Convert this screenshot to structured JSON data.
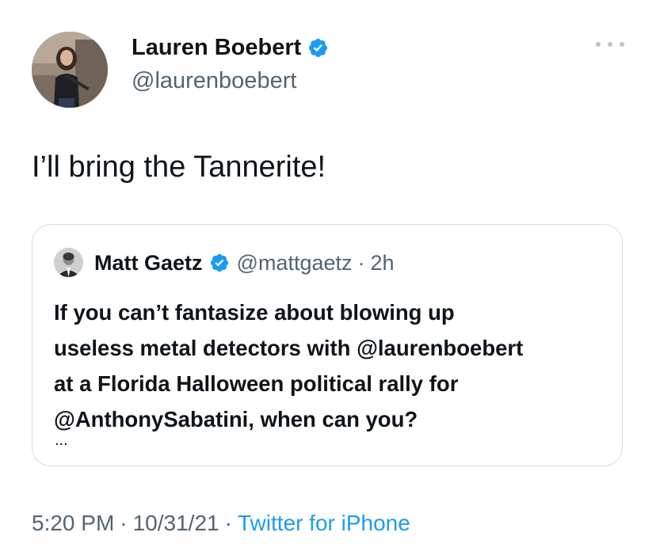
{
  "tweet": {
    "author": {
      "name": "Lauren Boebert",
      "handle": "@laurenboebert",
      "verified": true
    },
    "text": "I’ll bring the Tannerite!",
    "time": "5:20 PM",
    "date": "10/31/21",
    "separator": "·",
    "source": "Twitter for iPhone"
  },
  "quoted_tweet": {
    "author": {
      "name": "Matt Gaetz",
      "handle": "@mattgaetz",
      "verified": true
    },
    "separator": "·",
    "age": "2h",
    "text_lines": [
      "If you can’t fantasize about blowing up",
      "useless metal detectors with @laurenboebert",
      "at a Florida Halloween political rally for",
      "@AnthonySabatini, when can you?"
    ],
    "truncation": "..."
  },
  "icons": {
    "verified": "verified-badge-icon",
    "more": "more-options-icon"
  },
  "colors": {
    "link": "#1d9bf0",
    "secondary_text": "#536471",
    "border": "#d6dde2"
  }
}
